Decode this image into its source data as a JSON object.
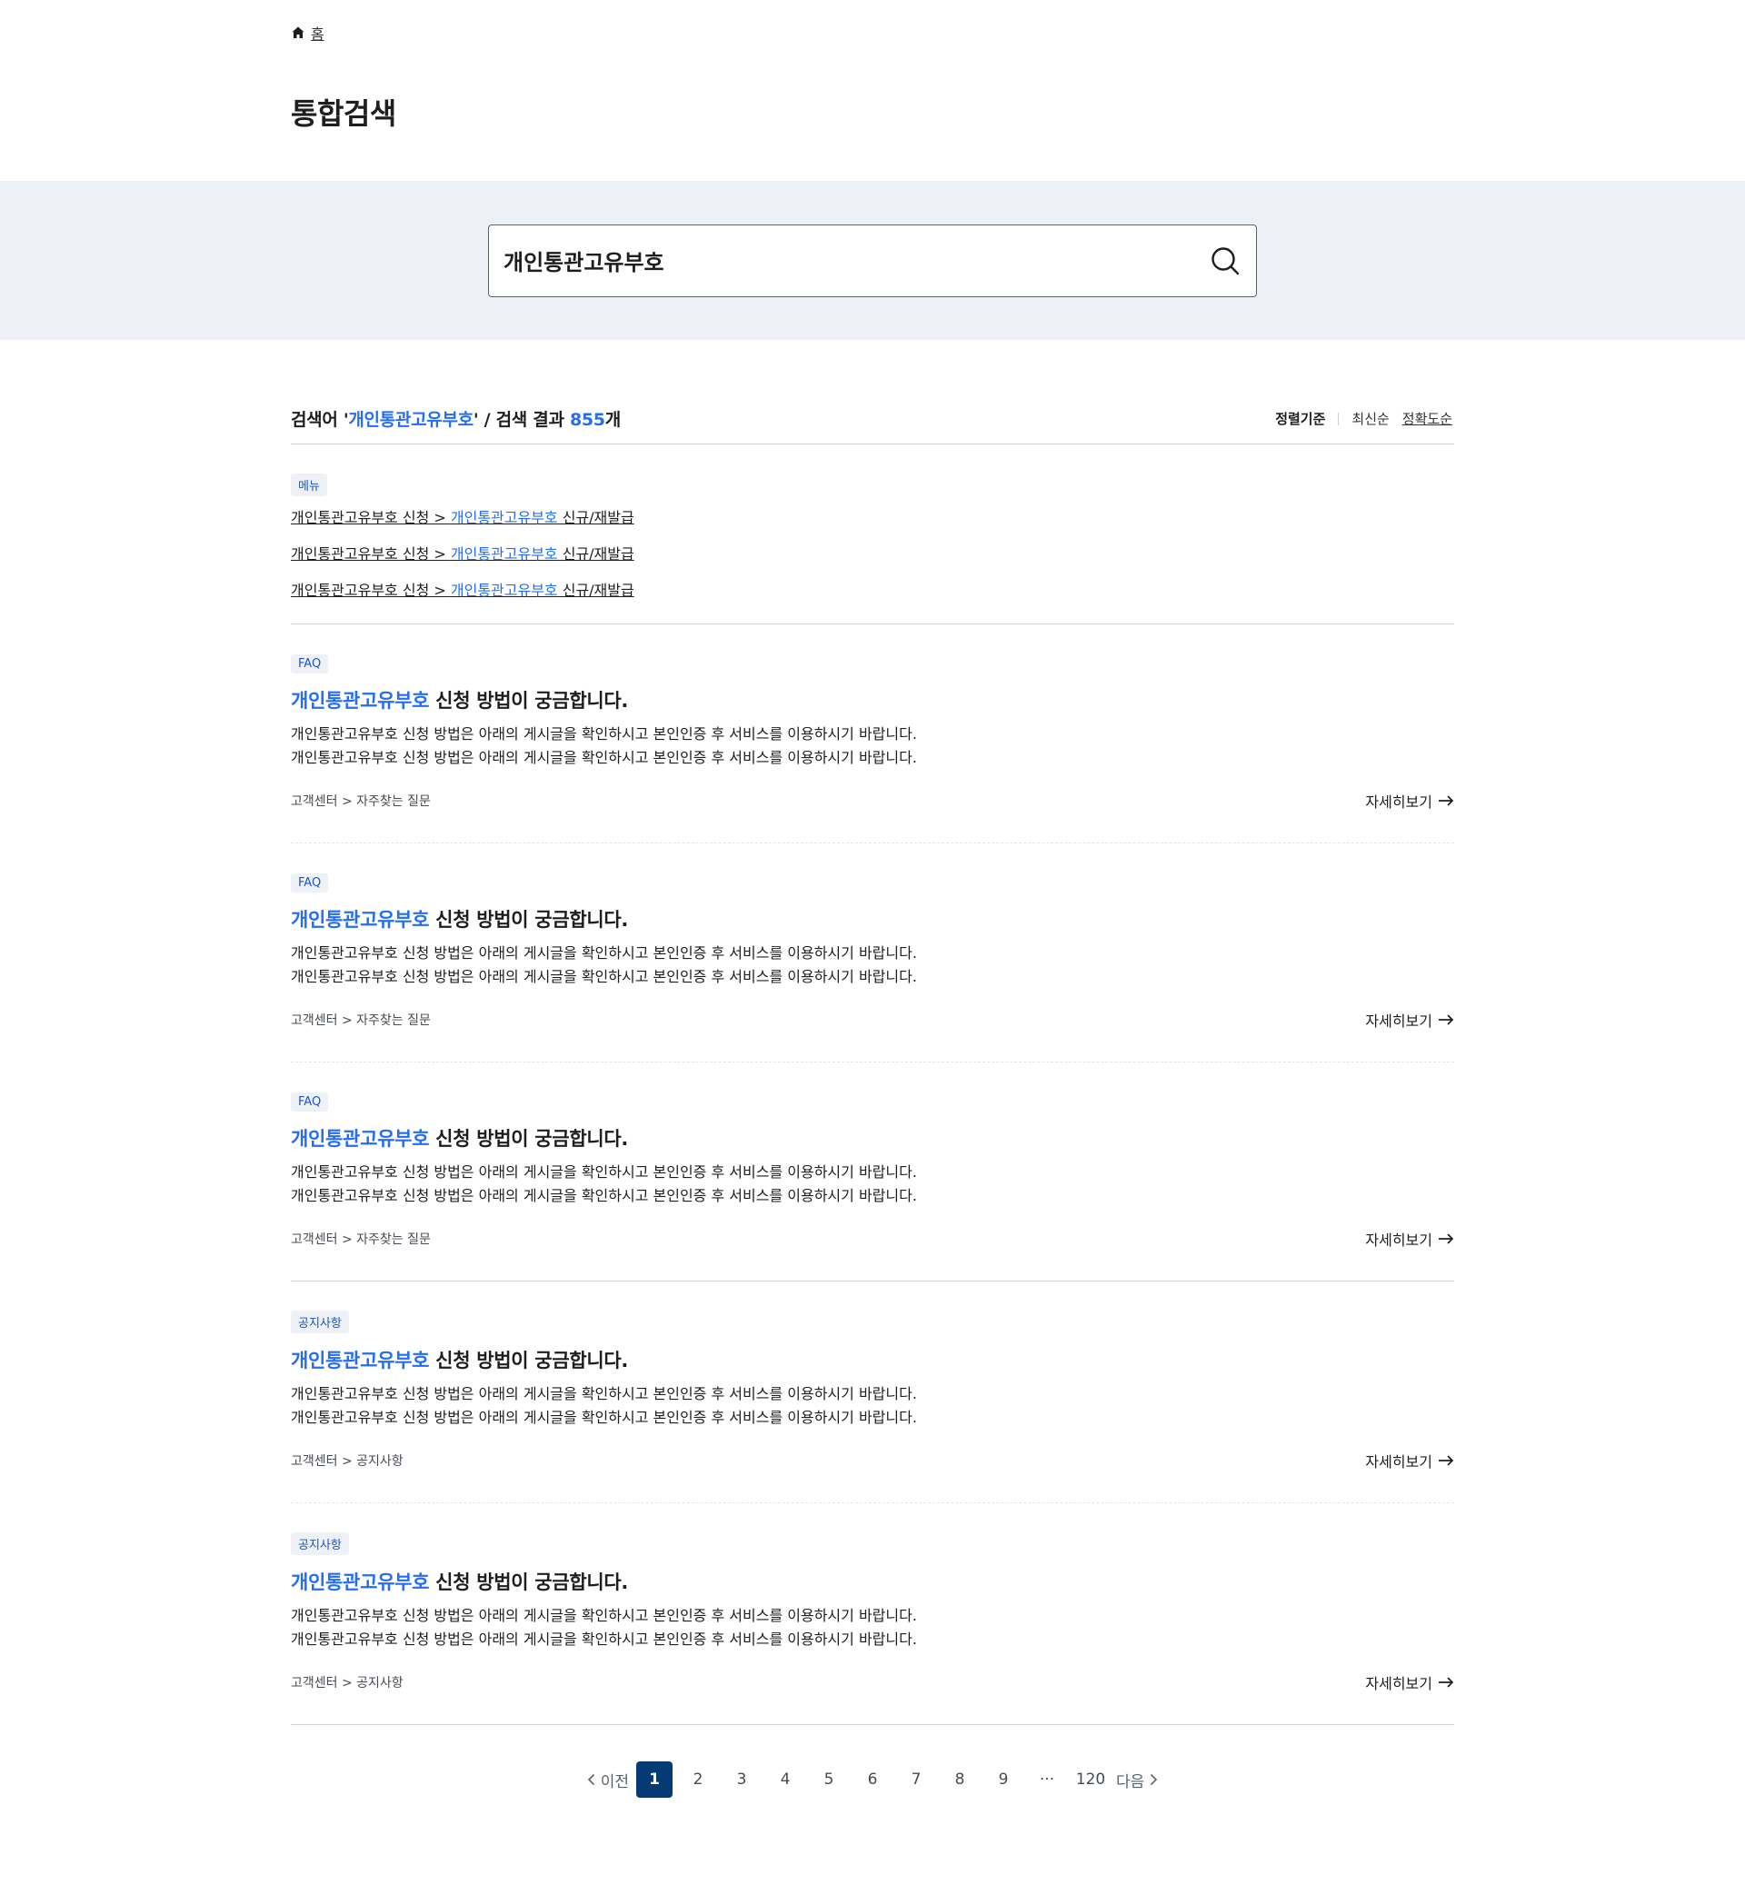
{
  "breadcrumb": {
    "home_label": "홈"
  },
  "page_title": "통합검색",
  "search": {
    "value": "개인통관고유부호"
  },
  "summary": {
    "prefix": "검색어 '",
    "keyword": "개인통관고유부호",
    "mid": "' / 검색 결과 ",
    "count": "855",
    "suffix": "개"
  },
  "sort": {
    "label": "정렬기준",
    "options": [
      "최신순",
      "정확도순"
    ],
    "active": "정확도순"
  },
  "menu_section": {
    "tag": "메뉴",
    "links": [
      {
        "pre": "개인통관고유부호 신청 > ",
        "hl": "개인통관고유부호",
        "post": " 신규/재발급"
      },
      {
        "pre": "개인통관고유부호 신청 > ",
        "hl": "개인통관고유부호",
        "post": " 신규/재발급"
      },
      {
        "pre": "개인통관고유부호 신청 > ",
        "hl": "개인통관고유부호",
        "post": " 신규/재발급"
      }
    ]
  },
  "results": [
    {
      "tag": "FAQ",
      "title_hl": "개인통관고유부호",
      "title_rest": " 신청 방법이 궁금합니다.",
      "desc1": "개인통관고유부호 신청 방법은 아래의 게시글을 확인하시고 본인인증 후 서비스를 이용하시기 바랍니다.",
      "desc2": "개인통관고유부호 신청 방법은 아래의 게시글을 확인하시고 본인인증 후 서비스를 이용하시기 바랍니다.",
      "path": "고객센터 > 자주찾는 질문",
      "more": "자세히보기"
    },
    {
      "tag": "FAQ",
      "title_hl": "개인통관고유부호",
      "title_rest": " 신청 방법이 궁금합니다.",
      "desc1": "개인통관고유부호 신청 방법은 아래의 게시글을 확인하시고 본인인증 후 서비스를 이용하시기 바랍니다.",
      "desc2": "개인통관고유부호 신청 방법은 아래의 게시글을 확인하시고 본인인증 후 서비스를 이용하시기 바랍니다.",
      "path": "고객센터 > 자주찾는 질문",
      "more": "자세히보기"
    },
    {
      "tag": "FAQ",
      "title_hl": "개인통관고유부호",
      "title_rest": " 신청 방법이 궁금합니다.",
      "desc1": "개인통관고유부호 신청 방법은 아래의 게시글을 확인하시고 본인인증 후 서비스를 이용하시기 바랍니다.",
      "desc2": "개인통관고유부호 신청 방법은 아래의 게시글을 확인하시고 본인인증 후 서비스를 이용하시기 바랍니다.",
      "path": "고객센터 > 자주찾는 질문",
      "more": "자세히보기"
    },
    {
      "tag": "공지사항",
      "title_hl": "개인통관고유부호",
      "title_rest": " 신청 방법이 궁금합니다.",
      "desc1": "개인통관고유부호 신청 방법은 아래의 게시글을 확인하시고 본인인증 후 서비스를 이용하시기 바랍니다.",
      "desc2": "개인통관고유부호 신청 방법은 아래의 게시글을 확인하시고 본인인증 후 서비스를 이용하시기 바랍니다.",
      "path": "고객센터 > 공지사항",
      "more": "자세히보기"
    },
    {
      "tag": "공지사항",
      "title_hl": "개인통관고유부호",
      "title_rest": " 신청 방법이 궁금합니다.",
      "desc1": "개인통관고유부호 신청 방법은 아래의 게시글을 확인하시고 본인인증 후 서비스를 이용하시기 바랍니다.",
      "desc2": "개인통관고유부호 신청 방법은 아래의 게시글을 확인하시고 본인인증 후 서비스를 이용하시기 바랍니다.",
      "path": "고객센터 > 공지사항",
      "more": "자세히보기"
    }
  ],
  "pagination": {
    "prev": "이전",
    "pages": [
      "1",
      "2",
      "3",
      "4",
      "5",
      "6",
      "7",
      "8",
      "9"
    ],
    "active": "1",
    "ellipsis": "···",
    "last": "120",
    "next": "다음"
  },
  "colors": {
    "accent": "#256ef4",
    "active_page": "#063a74",
    "search_band": "#edf0f5"
  },
  "icons": {
    "home": "home-icon",
    "search": "search-icon",
    "arrow": "arrow-right-icon",
    "chevron_left": "chevron-left-icon",
    "chevron_right": "chevron-right-icon"
  }
}
